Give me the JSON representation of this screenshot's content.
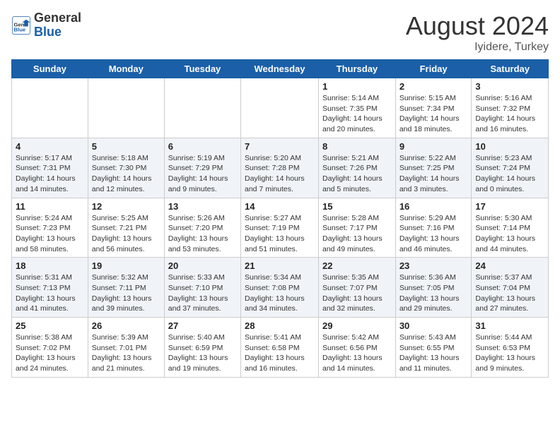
{
  "header": {
    "logo_general": "General",
    "logo_blue": "Blue",
    "month_year": "August 2024",
    "location": "Iyidere, Turkey"
  },
  "days_of_week": [
    "Sunday",
    "Monday",
    "Tuesday",
    "Wednesday",
    "Thursday",
    "Friday",
    "Saturday"
  ],
  "weeks": [
    [
      {
        "day": "",
        "info": ""
      },
      {
        "day": "",
        "info": ""
      },
      {
        "day": "",
        "info": ""
      },
      {
        "day": "",
        "info": ""
      },
      {
        "day": "1",
        "info": "Sunrise: 5:14 AM\nSunset: 7:35 PM\nDaylight: 14 hours and 20 minutes."
      },
      {
        "day": "2",
        "info": "Sunrise: 5:15 AM\nSunset: 7:34 PM\nDaylight: 14 hours and 18 minutes."
      },
      {
        "day": "3",
        "info": "Sunrise: 5:16 AM\nSunset: 7:32 PM\nDaylight: 14 hours and 16 minutes."
      }
    ],
    [
      {
        "day": "4",
        "info": "Sunrise: 5:17 AM\nSunset: 7:31 PM\nDaylight: 14 hours and 14 minutes."
      },
      {
        "day": "5",
        "info": "Sunrise: 5:18 AM\nSunset: 7:30 PM\nDaylight: 14 hours and 12 minutes."
      },
      {
        "day": "6",
        "info": "Sunrise: 5:19 AM\nSunset: 7:29 PM\nDaylight: 14 hours and 9 minutes."
      },
      {
        "day": "7",
        "info": "Sunrise: 5:20 AM\nSunset: 7:28 PM\nDaylight: 14 hours and 7 minutes."
      },
      {
        "day": "8",
        "info": "Sunrise: 5:21 AM\nSunset: 7:26 PM\nDaylight: 14 hours and 5 minutes."
      },
      {
        "day": "9",
        "info": "Sunrise: 5:22 AM\nSunset: 7:25 PM\nDaylight: 14 hours and 3 minutes."
      },
      {
        "day": "10",
        "info": "Sunrise: 5:23 AM\nSunset: 7:24 PM\nDaylight: 14 hours and 0 minutes."
      }
    ],
    [
      {
        "day": "11",
        "info": "Sunrise: 5:24 AM\nSunset: 7:23 PM\nDaylight: 13 hours and 58 minutes."
      },
      {
        "day": "12",
        "info": "Sunrise: 5:25 AM\nSunset: 7:21 PM\nDaylight: 13 hours and 56 minutes."
      },
      {
        "day": "13",
        "info": "Sunrise: 5:26 AM\nSunset: 7:20 PM\nDaylight: 13 hours and 53 minutes."
      },
      {
        "day": "14",
        "info": "Sunrise: 5:27 AM\nSunset: 7:19 PM\nDaylight: 13 hours and 51 minutes."
      },
      {
        "day": "15",
        "info": "Sunrise: 5:28 AM\nSunset: 7:17 PM\nDaylight: 13 hours and 49 minutes."
      },
      {
        "day": "16",
        "info": "Sunrise: 5:29 AM\nSunset: 7:16 PM\nDaylight: 13 hours and 46 minutes."
      },
      {
        "day": "17",
        "info": "Sunrise: 5:30 AM\nSunset: 7:14 PM\nDaylight: 13 hours and 44 minutes."
      }
    ],
    [
      {
        "day": "18",
        "info": "Sunrise: 5:31 AM\nSunset: 7:13 PM\nDaylight: 13 hours and 41 minutes."
      },
      {
        "day": "19",
        "info": "Sunrise: 5:32 AM\nSunset: 7:11 PM\nDaylight: 13 hours and 39 minutes."
      },
      {
        "day": "20",
        "info": "Sunrise: 5:33 AM\nSunset: 7:10 PM\nDaylight: 13 hours and 37 minutes."
      },
      {
        "day": "21",
        "info": "Sunrise: 5:34 AM\nSunset: 7:08 PM\nDaylight: 13 hours and 34 minutes."
      },
      {
        "day": "22",
        "info": "Sunrise: 5:35 AM\nSunset: 7:07 PM\nDaylight: 13 hours and 32 minutes."
      },
      {
        "day": "23",
        "info": "Sunrise: 5:36 AM\nSunset: 7:05 PM\nDaylight: 13 hours and 29 minutes."
      },
      {
        "day": "24",
        "info": "Sunrise: 5:37 AM\nSunset: 7:04 PM\nDaylight: 13 hours and 27 minutes."
      }
    ],
    [
      {
        "day": "25",
        "info": "Sunrise: 5:38 AM\nSunset: 7:02 PM\nDaylight: 13 hours and 24 minutes."
      },
      {
        "day": "26",
        "info": "Sunrise: 5:39 AM\nSunset: 7:01 PM\nDaylight: 13 hours and 21 minutes."
      },
      {
        "day": "27",
        "info": "Sunrise: 5:40 AM\nSunset: 6:59 PM\nDaylight: 13 hours and 19 minutes."
      },
      {
        "day": "28",
        "info": "Sunrise: 5:41 AM\nSunset: 6:58 PM\nDaylight: 13 hours and 16 minutes."
      },
      {
        "day": "29",
        "info": "Sunrise: 5:42 AM\nSunset: 6:56 PM\nDaylight: 13 hours and 14 minutes."
      },
      {
        "day": "30",
        "info": "Sunrise: 5:43 AM\nSunset: 6:55 PM\nDaylight: 13 hours and 11 minutes."
      },
      {
        "day": "31",
        "info": "Sunrise: 5:44 AM\nSunset: 6:53 PM\nDaylight: 13 hours and 9 minutes."
      }
    ]
  ]
}
